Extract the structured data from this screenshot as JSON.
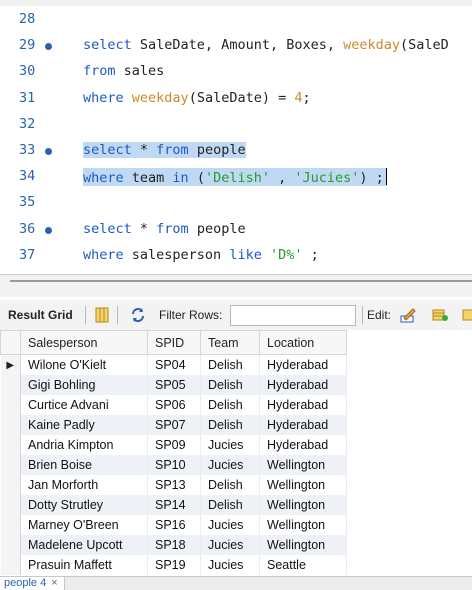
{
  "editor": {
    "lines": [
      {
        "num": "28",
        "dot": false,
        "tokens": []
      },
      {
        "num": "29",
        "dot": true,
        "tokens": [
          {
            "t": "select",
            "c": "kw"
          },
          {
            "t": " SaleDate, Amount, Boxes, ",
            "c": "op"
          },
          {
            "t": "weekday",
            "c": "fn"
          },
          {
            "t": "(SaleD",
            "c": "op"
          }
        ]
      },
      {
        "num": "30",
        "dot": false,
        "tokens": [
          {
            "t": "from",
            "c": "kw"
          },
          {
            "t": " sales",
            "c": "op"
          }
        ]
      },
      {
        "num": "31",
        "dot": false,
        "tokens": [
          {
            "t": "where",
            "c": "kw"
          },
          {
            "t": " ",
            "c": "op"
          },
          {
            "t": "weekday",
            "c": "fn"
          },
          {
            "t": "(SaleDate) = ",
            "c": "op"
          },
          {
            "t": "4",
            "c": "fn"
          },
          {
            "t": ";",
            "c": "op"
          }
        ]
      },
      {
        "num": "32",
        "dot": false,
        "tokens": []
      },
      {
        "num": "33",
        "dot": true,
        "highlight": true,
        "tokens": [
          {
            "t": "select",
            "c": "kw"
          },
          {
            "t": " * ",
            "c": "op"
          },
          {
            "t": "from",
            "c": "kw"
          },
          {
            "t": " people",
            "c": "op"
          }
        ]
      },
      {
        "num": "34",
        "dot": false,
        "highlight": true,
        "caret": true,
        "tokens": [
          {
            "t": "where",
            "c": "kw"
          },
          {
            "t": " team ",
            "c": "op"
          },
          {
            "t": "in",
            "c": "kw"
          },
          {
            "t": " (",
            "c": "op"
          },
          {
            "t": "'Delish'",
            "c": "str"
          },
          {
            "t": " , ",
            "c": "op"
          },
          {
            "t": "'Jucies'",
            "c": "str"
          },
          {
            "t": ") ;",
            "c": "op"
          }
        ]
      },
      {
        "num": "35",
        "dot": false,
        "tokens": []
      },
      {
        "num": "36",
        "dot": true,
        "tokens": [
          {
            "t": "select",
            "c": "kw"
          },
          {
            "t": " * ",
            "c": "op"
          },
          {
            "t": "from",
            "c": "kw"
          },
          {
            "t": " people",
            "c": "op"
          }
        ]
      },
      {
        "num": "37",
        "dot": false,
        "tokens": [
          {
            "t": "where",
            "c": "kw"
          },
          {
            "t": " salesperson ",
            "c": "op"
          },
          {
            "t": "like",
            "c": "kw"
          },
          {
            "t": " ",
            "c": "op"
          },
          {
            "t": "'D%'",
            "c": "str"
          },
          {
            "t": " ;",
            "c": "op"
          }
        ]
      }
    ],
    "colors": {
      "keyword": "#1c59c7",
      "function": "#c88b2a",
      "string": "#2a9a2a",
      "selection": "#bfd9f4",
      "line_number": "#2a62b0"
    }
  },
  "result_toolbar": {
    "label": "Result Grid",
    "filter_label": "Filter Rows:",
    "filter_value": "",
    "edit_label": "Edit:"
  },
  "grid": {
    "columns": [
      "Salesperson",
      "SPID",
      "Team",
      "Location"
    ],
    "rows": [
      [
        "Wilone O'Kielt",
        "SP04",
        "Delish",
        "Hyderabad"
      ],
      [
        "Gigi Bohling",
        "SP05",
        "Delish",
        "Hyderabad"
      ],
      [
        "Curtice Advani",
        "SP06",
        "Delish",
        "Hyderabad"
      ],
      [
        "Kaine Padly",
        "SP07",
        "Delish",
        "Hyderabad"
      ],
      [
        "Andria Kimpton",
        "SP09",
        "Jucies",
        "Hyderabad"
      ],
      [
        "Brien Boise",
        "SP10",
        "Jucies",
        "Wellington"
      ],
      [
        "Jan Morforth",
        "SP13",
        "Delish",
        "Wellington"
      ],
      [
        "Dotty Strutley",
        "SP14",
        "Delish",
        "Wellington"
      ],
      [
        "Marney O'Breen",
        "SP16",
        "Jucies",
        "Wellington"
      ],
      [
        "Madelene Upcott",
        "SP18",
        "Jucies",
        "Wellington"
      ],
      [
        "Prasuin Maffett",
        "SP19",
        "Jucies",
        "Seattle"
      ]
    ],
    "current_row_marker": "▶"
  },
  "bottom_tabs": [
    {
      "label": "people 4",
      "close": "×"
    }
  ]
}
